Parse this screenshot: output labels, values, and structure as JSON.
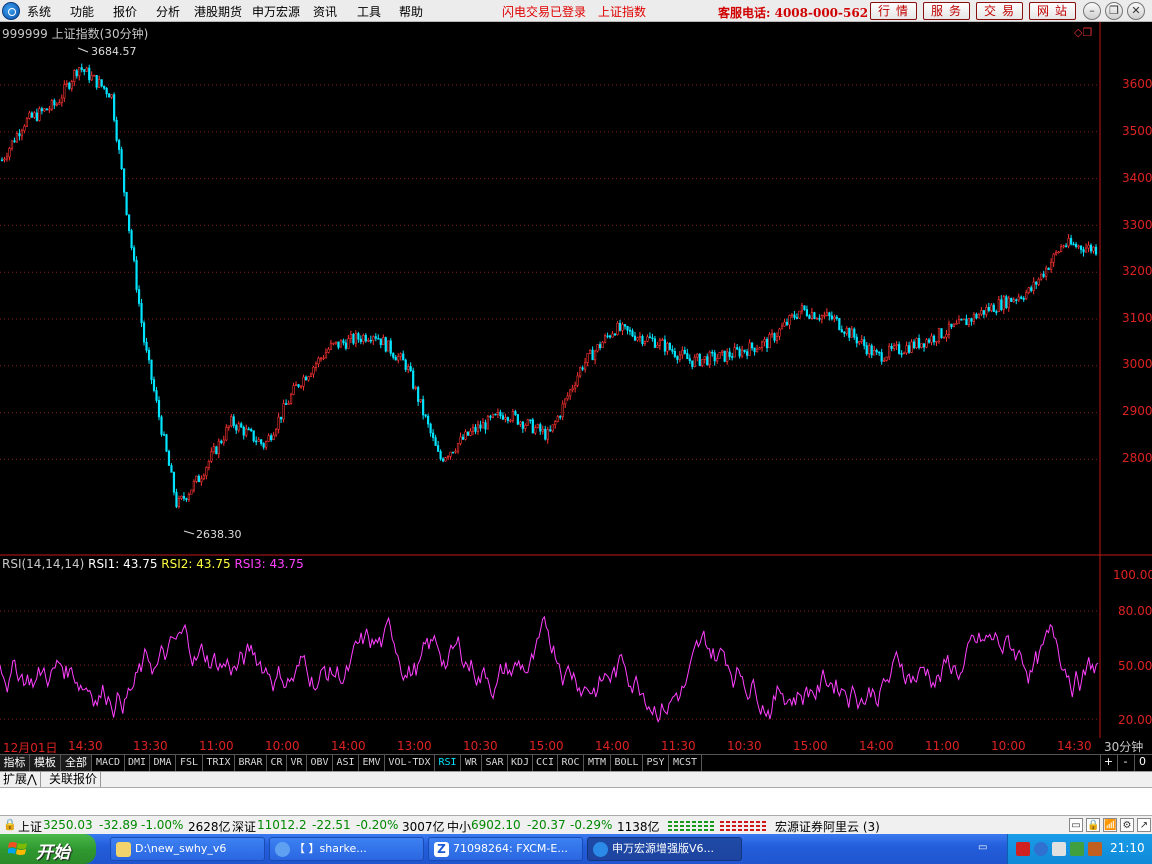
{
  "menubar": {
    "items": [
      "系统",
      "功能",
      "报价",
      "分析",
      "港股期货",
      "申万宏源",
      "资讯",
      "工具",
      "帮助"
    ],
    "status_login": "闪电交易已登录",
    "status_index": "上证指数",
    "hotline": "客服电话: 4008-000-562",
    "quick_buttons": [
      "行情",
      "服务",
      "交易",
      "网站"
    ]
  },
  "chart": {
    "title": "999999 上证指数(30分钟)",
    "high_label": "3684.57",
    "low_label": "2638.30",
    "price_ticks": [
      "3600",
      "3500",
      "3400",
      "3300",
      "3200",
      "3100",
      "3000",
      "2900",
      "2800"
    ],
    "rsi_ticks": [
      "100.00",
      "80.00",
      "50.00",
      "20.00"
    ],
    "time_labels": [
      "12月01日",
      "14:30",
      "13:30",
      "11:00",
      "10:00",
      "14:00",
      "13:00",
      "10:30",
      "15:00",
      "14:00",
      "11:30",
      "10:30",
      "15:00",
      "14:00",
      "11:00",
      "10:00",
      "14:30"
    ],
    "period": "30分钟",
    "colors": {
      "up": "#ff3333",
      "down": "#00e5ff",
      "rsi": "#ff40ff",
      "grid": "#8b1a1a",
      "axis": "#c01818"
    }
  },
  "chart_data": {
    "type": "candlestick",
    "title": "999999 上证指数(30分钟)",
    "ylim": [
      2600,
      3720
    ],
    "y_ticks": [
      2800,
      2900,
      3000,
      3100,
      3200,
      3300,
      3400,
      3500,
      3600
    ],
    "high": 3684.57,
    "low": 2638.3,
    "close_path_x": [
      0,
      0.02,
      0.05,
      0.07,
      0.1,
      0.13,
      0.16,
      0.18,
      0.21,
      0.24,
      0.27,
      0.3,
      0.34,
      0.37,
      0.4,
      0.43,
      0.46,
      0.5,
      0.53,
      0.56,
      0.6,
      0.63,
      0.66,
      0.7,
      0.73,
      0.76,
      0.8,
      0.84,
      0.87,
      0.9,
      0.94,
      0.97,
      1.0
    ],
    "close_path_y": [
      3440,
      3520,
      3560,
      3640,
      3580,
      3050,
      2700,
      2760,
      2880,
      2830,
      2960,
      3040,
      3070,
      3000,
      2800,
      2860,
      2900,
      2850,
      3000,
      3080,
      3050,
      3010,
      3020,
      3050,
      3120,
      3100,
      3020,
      3050,
      3080,
      3120,
      3160,
      3260,
      3250
    ],
    "rsi": {
      "name": "RSI(14,14,14)",
      "rsi1": 43.75,
      "rsi2": 43.75,
      "rsi3": 43.75,
      "ylim": [
        0,
        100
      ],
      "y_ticks": [
        20,
        50,
        80,
        100
      ]
    },
    "x_labels": [
      "12月01日",
      "14:30",
      "13:30",
      "11:00",
      "10:00",
      "14:00",
      "13:00",
      "10:30",
      "15:00",
      "14:00",
      "11:30",
      "10:30",
      "15:00",
      "14:00",
      "11:00",
      "10:00",
      "14:30"
    ]
  },
  "rsi_legend": {
    "name": "RSI(14,14,14)",
    "rsi1": "RSI1: 43.75",
    "rsi2": "RSI2: 43.75",
    "rsi3": "RSI3: 43.75"
  },
  "indicator_tabs": {
    "left": [
      "指标",
      "模板",
      "全部"
    ],
    "items": [
      "MACD",
      "DMI",
      "DMA",
      "FSL",
      "TRIX",
      "BRAR",
      "CR",
      "VR",
      "OBV",
      "ASI",
      "EMV",
      "VOL-TDX",
      "RSI",
      "WR",
      "SAR",
      "KDJ",
      "CCI",
      "ROC",
      "MTM",
      "BOLL",
      "PSY",
      "MCST"
    ],
    "active": "RSI",
    "controls": [
      "+",
      "-",
      "0"
    ]
  },
  "sub_tabs": [
    "扩展⋀",
    "关联报价"
  ],
  "ticker": {
    "sh_label": "上证",
    "sh_value": "3250.03",
    "sh_change": "-32.89",
    "sh_pct": "-1.00%",
    "sh_amount": "2628亿",
    "sz_label": "深证",
    "sz_value": "11012.2",
    "sz_change": "-22.51",
    "sz_pct": "-0.20%",
    "sz_amount": "3007亿",
    "zx_label": "中小",
    "zx_value": "6902.10",
    "zx_change": "-20.37",
    "zx_pct": "-0.29%",
    "zx_amount": "1138亿",
    "broker": "宏源证券阿里云 (3)"
  },
  "taskbar": {
    "start": "开始",
    "tasks": [
      "D:\\new_swhy_v6",
      "【       】sharke...",
      "71098264: FXCM-E...",
      "申万宏源增强版V6..."
    ],
    "clock": "21:10"
  }
}
